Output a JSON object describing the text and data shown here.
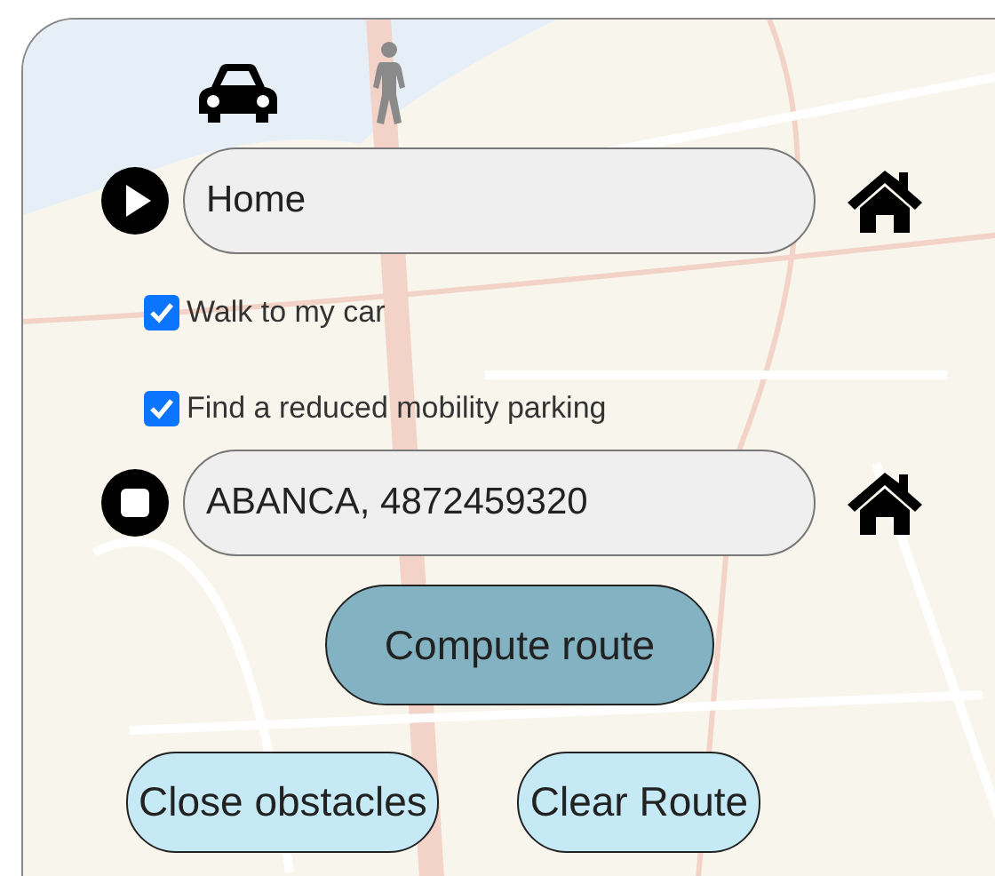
{
  "transport_modes": [
    {
      "kind": "car",
      "selected": true
    },
    {
      "kind": "walk",
      "selected": false
    }
  ],
  "origin": {
    "value": "Home"
  },
  "options": [
    {
      "label": "Walk to my car",
      "checked": true
    },
    {
      "label": "Find a reduced mobility parking",
      "checked": true
    }
  ],
  "destination": {
    "value": "ABANCA, 4872459320"
  },
  "primary_button": "Compute route",
  "buttons": [
    "Close obstacles",
    "Clear Route"
  ]
}
